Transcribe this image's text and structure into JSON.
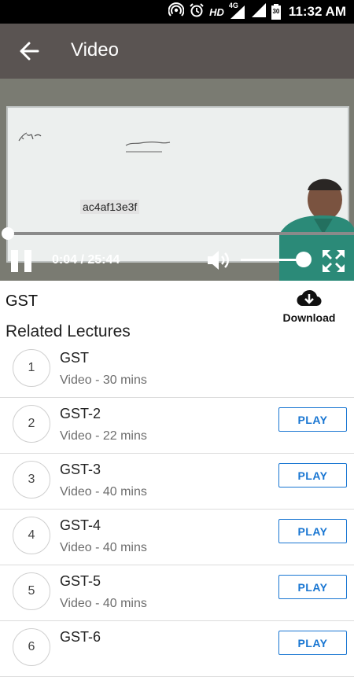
{
  "status_bar": {
    "hd": "HD",
    "network": "4G",
    "battery": "30",
    "time": "11:32 AM"
  },
  "app_bar": {
    "title": "Video",
    "back_icon": "arrow-back-icon"
  },
  "player": {
    "watermark": "ac4af13e3f",
    "time_display": "0:04 / 25:44",
    "progress": 0.003,
    "volume": 0.9,
    "icons": [
      "pause-icon",
      "volume-icon",
      "fullscreen-icon"
    ]
  },
  "lecture": {
    "title": "GST",
    "download_label": "Download"
  },
  "related": {
    "heading": "Related Lectures",
    "items": [
      {
        "number": "1",
        "title": "GST",
        "subtitle": "Video - 30 mins",
        "play": ""
      },
      {
        "number": "2",
        "title": "GST-2",
        "subtitle": "Video - 22 mins",
        "play": "PLAY"
      },
      {
        "number": "3",
        "title": "GST-3",
        "subtitle": "Video - 40 mins",
        "play": "PLAY"
      },
      {
        "number": "4",
        "title": "GST-4",
        "subtitle": "Video - 40 mins",
        "play": "PLAY"
      },
      {
        "number": "5",
        "title": "GST-5",
        "subtitle": "Video - 40 mins",
        "play": "PLAY"
      },
      {
        "number": "6",
        "title": "GST-6",
        "subtitle": "",
        "play": "PLAY"
      }
    ]
  },
  "colors": {
    "app_bar": "#5a5452",
    "accent": "#1976d2",
    "status_bar": "#000000"
  }
}
